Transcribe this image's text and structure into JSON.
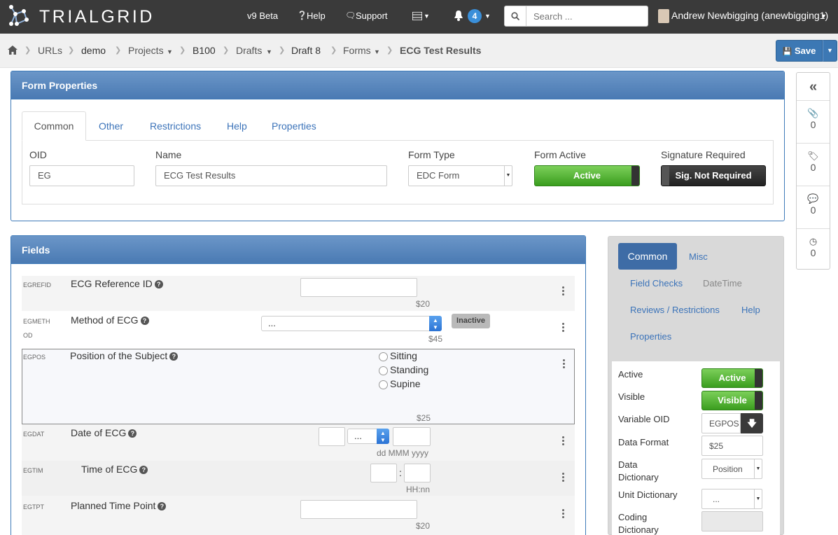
{
  "nav": {
    "brand": "TRIALGRID",
    "links": [
      "v9 Beta",
      "Help",
      "Support"
    ],
    "notification_count": "4",
    "search_placeholder": "Search ...",
    "user": "Andrew Newbigging (anewbigging1)"
  },
  "breadcrumb": {
    "items": [
      "URLs",
      "demo",
      "Projects",
      "B100",
      "Drafts",
      "Draft 8",
      "Forms",
      "ECG Test Results"
    ],
    "save_label": "Save"
  },
  "form_properties": {
    "title": "Form Properties",
    "tabs": [
      "Common",
      "Other",
      "Restrictions",
      "Help",
      "Properties"
    ],
    "oid_label": "OID",
    "oid_value": "EG",
    "name_label": "Name",
    "name_value": "ECG Test Results",
    "form_type_label": "Form Type",
    "form_type_value": "EDC Form",
    "form_active_label": "Form Active",
    "form_active_value": "Active",
    "signature_label": "Signature Required",
    "signature_value": "Sig. Not Required"
  },
  "fields": {
    "title": "Fields",
    "rows": [
      {
        "oid": "EGREFID",
        "label": "ECG Reference ID",
        "format": "$20"
      },
      {
        "oid": "EGMETH",
        "oid2": "OD",
        "label": "Method of ECG",
        "select": "...",
        "format": "$45",
        "badge": "Inactive"
      },
      {
        "oid": "EGPOS",
        "label": "Position of the Subject",
        "options": [
          "Sitting",
          "Standing",
          "Supine"
        ],
        "format": "$25"
      },
      {
        "oid": "EGDAT",
        "label": "Date of ECG",
        "select": "...",
        "format": "dd MMM yyyy"
      },
      {
        "oid": "EGTIM",
        "label": "Time of ECG",
        "sep": ":",
        "format": "HH:nn"
      },
      {
        "oid": "EGTPT",
        "label": "Planned Time Point",
        "format": "$20"
      }
    ]
  },
  "field_props": {
    "tabs": [
      "Common",
      "Misc",
      "Field Checks",
      "DateTime",
      "Reviews / Restrictions",
      "Help",
      "Properties"
    ],
    "active_label": "Active",
    "active_value": "Active",
    "visible_label": "Visible",
    "visible_value": "Visible",
    "variable_oid_label": "Variable OID",
    "variable_oid_value": "EGPOS",
    "data_format_label": "Data Format",
    "data_format_value": "$25",
    "data_dictionary_label_1": "Data",
    "data_dictionary_label_2": "Dictionary",
    "data_dictionary_value": "Position",
    "unit_dictionary_label": "Unit Dictionary",
    "unit_dictionary_value": "...",
    "coding_dictionary_label_1": "Coding",
    "coding_dictionary_label_2": "Dictionary"
  },
  "toolbar": {
    "counts": [
      "0",
      "0",
      "0",
      "0"
    ]
  }
}
